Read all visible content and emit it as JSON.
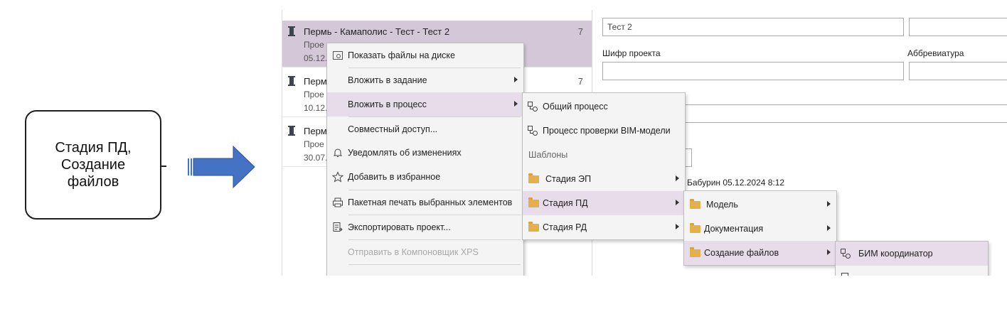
{
  "callout": {
    "text_line1": "Стадия ПД,",
    "text_line2": "Создание",
    "text_line3": "файлов"
  },
  "colors": {
    "arrow": "#4472c4",
    "selection": "#d4c8d8",
    "menu_highlight": "#e6dcea",
    "folder": "#e3b04b"
  },
  "projects": [
    {
      "title": "Пермь - Камаполис - Тест - Тест 2",
      "line1": "Прое",
      "line2": "05.12.",
      "count": "7"
    },
    {
      "title": "Перм",
      "line1": "Прое",
      "line2": "10.12.",
      "count": "7"
    },
    {
      "title": "Перм",
      "line1": "Прое",
      "line2": "30.07.",
      "count": ""
    }
  ],
  "form": {
    "name_value": "Тест 2",
    "cipher_label": "Шифр проекта",
    "abbr_label": "Аббревиатура",
    "partial_text": "Бабурин 05.12.2024 8:12"
  },
  "context_menu": {
    "show_files": "Показать файлы на диске",
    "attach_task": "Вложить в задание",
    "attach_process": "Вложить в процесс",
    "shared_access": "Совместный доступ...",
    "notify": "Уведомлять об изменениях",
    "favorite": "Добавить в избранное",
    "batch_print": "Пакетная печать выбранных элементов",
    "export": "Экспортировать проект...",
    "send_xps": "Отправить в Компоновщик XPS"
  },
  "process_menu": {
    "general": "Общий процесс",
    "bim_check": "Процесс проверки BIM-модели",
    "templates_header": "Шаблоны",
    "stage_ep": "Стадия ЭП",
    "stage_pd": "Стадия ПД",
    "stage_rd": "Стадия РД"
  },
  "pd_menu": {
    "model": "Модель",
    "documentation": "Документация",
    "create_files": "Создание файлов"
  },
  "files_menu": {
    "bim_coordinator": "БИМ координатор"
  }
}
